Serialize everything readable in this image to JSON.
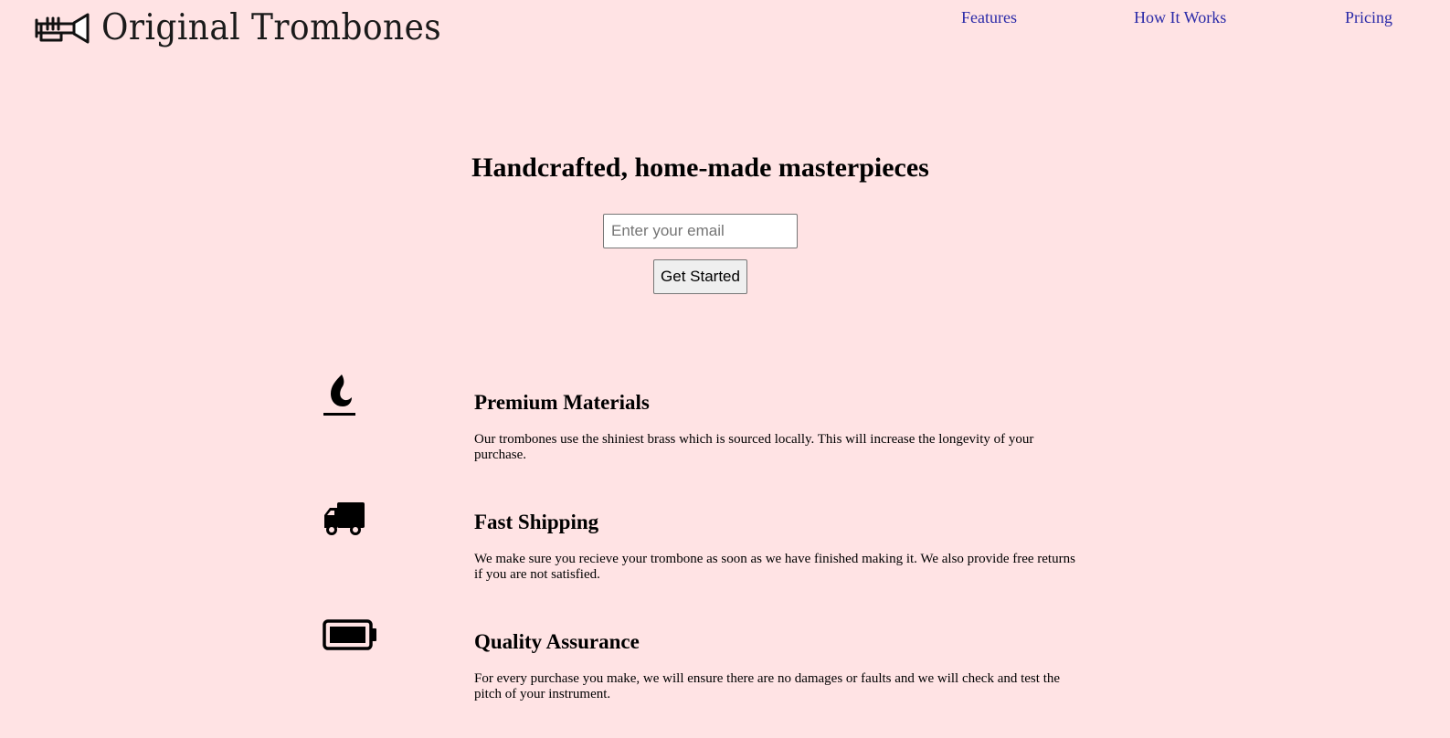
{
  "header": {
    "logo_text": "Original Trombones",
    "logo_icon": "trombone-icon",
    "nav": [
      {
        "label": "Features"
      },
      {
        "label": "How It Works"
      },
      {
        "label": "Pricing"
      }
    ]
  },
  "hero": {
    "title": "Handcrafted, home-made masterpieces",
    "email_placeholder": "Enter your email",
    "button_label": "Get Started"
  },
  "features": [
    {
      "icon": "fire-icon",
      "title": "Premium Materials",
      "description": "Our trombones use the shiniest brass which is sourced locally. This will increase the longevity of your purchase."
    },
    {
      "icon": "truck-icon",
      "title": "Fast Shipping",
      "description": "We make sure you recieve your trombone as soon as we have finished making it. We also provide free returns if you are not satisfied."
    },
    {
      "icon": "battery-full-icon",
      "title": "Quality Assurance",
      "description": "For every purchase you make, we will ensure there are no damages or faults and we will check and test the pitch of your instrument."
    }
  ],
  "colors": {
    "background": "#ffe3e4",
    "nav_link": "#2a2aa8"
  }
}
